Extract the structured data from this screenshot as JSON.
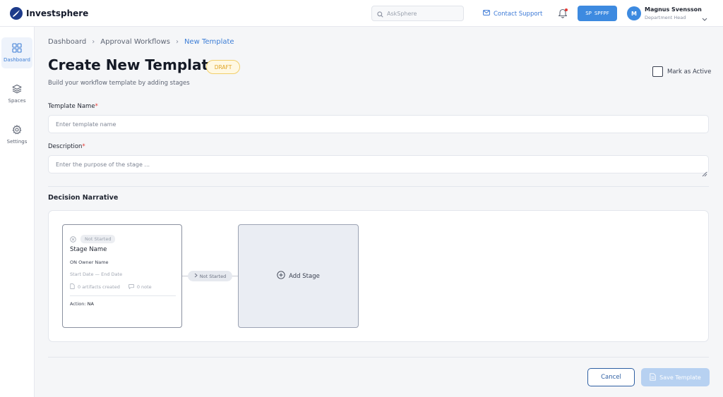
{
  "app": {
    "name": "Investsphere"
  },
  "header": {
    "search_placeholder": "AskSphere",
    "contact_support": "Contact Support",
    "space_button": {
      "initials": "SP",
      "label": "SPFPF"
    },
    "user": {
      "avatar_initial": "M",
      "name": "Magnus Svensson",
      "role": "Department Head"
    }
  },
  "sidebar": {
    "items": [
      {
        "label": "Dashboard",
        "icon": "grid-icon",
        "active": true
      },
      {
        "label": "Spaces",
        "icon": "layers-icon",
        "active": false
      },
      {
        "label": "Settings",
        "icon": "gear-icon",
        "active": false
      }
    ]
  },
  "breadcrumb": [
    "Dashboard",
    "Approval Workflows",
    "New Template"
  ],
  "page": {
    "title": "Create New Template",
    "status_badge": "DRAFT",
    "subtitle": "Build your workflow template by adding stages",
    "mark_active_label": "Mark as Active"
  },
  "form": {
    "template_name": {
      "label": "Template Name",
      "required_mark": "*",
      "placeholder": "Enter template name",
      "value": ""
    },
    "description": {
      "label": "Description",
      "required_mark": "*",
      "placeholder": "Enter the purpose of the stage ...",
      "value": ""
    }
  },
  "decision_narrative": {
    "title": "Decision Narrative",
    "stage_card": {
      "status": "Not Started",
      "name": "Stage Name",
      "owner_initials": "ON",
      "owner_name": "Owner Name",
      "dates": "Start Date — End Date",
      "artifacts": "0 artifacts created",
      "notes": "0 note",
      "action_label": "Action:",
      "action_value": "NA"
    },
    "connector_status": "Not Started",
    "add_stage_label": "Add Stage"
  },
  "actions": {
    "cancel": "Cancel",
    "save": "Save Template"
  },
  "colors": {
    "accent": "#3d8ae0",
    "link": "#3d7ed6",
    "draft": "#e0a526",
    "required": "#e53935",
    "save_disabled": "#b7d1f1"
  }
}
